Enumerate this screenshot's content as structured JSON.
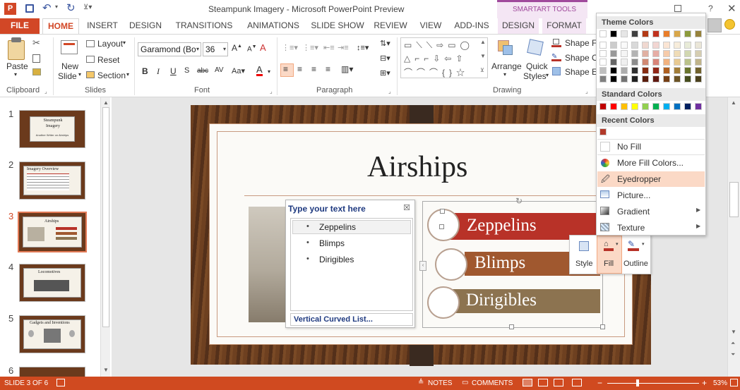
{
  "app": {
    "title": "Steampunk Imagery - Microsoft PowerPoint Preview",
    "context_group": "SMARTART TOOLS"
  },
  "tabs": [
    "FILE",
    "HOME",
    "INSERT",
    "DESIGN",
    "TRANSITIONS",
    "ANIMATIONS",
    "SLIDE SHOW",
    "REVIEW",
    "VIEW",
    "ADD-INS",
    "DESIGN",
    "FORMAT"
  ],
  "ribbon": {
    "clipboard": {
      "paste": "Paste",
      "label": "Clipboard"
    },
    "slides": {
      "new_slide_1": "New",
      "new_slide_2": "Slide",
      "layout": "Layout",
      "reset": "Reset",
      "section": "Section",
      "label": "Slides"
    },
    "font": {
      "name": "Garamond (Boo",
      "size": "36",
      "label": "Font"
    },
    "paragraph": {
      "label": "Paragraph"
    },
    "drawing": {
      "arrange": "Arrange",
      "quick_1": "Quick",
      "quick_2": "Styles",
      "shape_fill": "Shape Fill",
      "shape_outline": "Shape Ou",
      "shape_effects": "Shape Ef",
      "label": "Drawing"
    }
  },
  "thumbnails": [
    {
      "num": "1",
      "title": "Steampunk Imagery",
      "sub": "Another Writer on Airships"
    },
    {
      "num": "2",
      "title": "Imagery Overview"
    },
    {
      "num": "3",
      "title": "Airships"
    },
    {
      "num": "4",
      "title": "Locomotives"
    },
    {
      "num": "5",
      "title": "Gadgets and Inventions"
    },
    {
      "num": "6",
      "title": ""
    }
  ],
  "slide": {
    "title": "Airships",
    "text_pane": {
      "header": "Type your text here",
      "items": [
        "Zeppelins",
        "Blimps",
        "Dirigibles"
      ],
      "footer": "Vertical Curved List..."
    },
    "list_items": [
      "Zeppelins",
      "Blimps",
      "Dirigibles"
    ],
    "list_colors": [
      "#b83228",
      "#a0582f",
      "#8c7350"
    ]
  },
  "mini_toolbar": {
    "style": "Style",
    "fill": "Fill",
    "outline": "Outline"
  },
  "color_menu": {
    "theme_header": "Theme Colors",
    "standard_header": "Standard Colors",
    "recent_header": "Recent Colors",
    "no_fill": "No Fill",
    "more_fill": "More Fill Colors...",
    "eyedropper": "Eyedropper",
    "picture": "Picture...",
    "gradient": "Gradient",
    "texture": "Texture",
    "theme_colors": [
      "#ffffff",
      "#000000",
      "#e6e6e6",
      "#404040",
      "#b23a16",
      "#c0321f",
      "#e97e2a",
      "#d8a74a",
      "#8c9a3c",
      "#96823c"
    ],
    "standard_colors": [
      "#c00000",
      "#ff0000",
      "#ffc000",
      "#ffff00",
      "#92d050",
      "#00b050",
      "#00b0f0",
      "#0070c0",
      "#002060",
      "#7030a0"
    ],
    "recent_colors": [
      "#b23a2a"
    ]
  },
  "status": {
    "slide": "SLIDE 3 OF 6",
    "notes": "NOTES",
    "comments": "COMMENTS",
    "zoom": "53%"
  }
}
